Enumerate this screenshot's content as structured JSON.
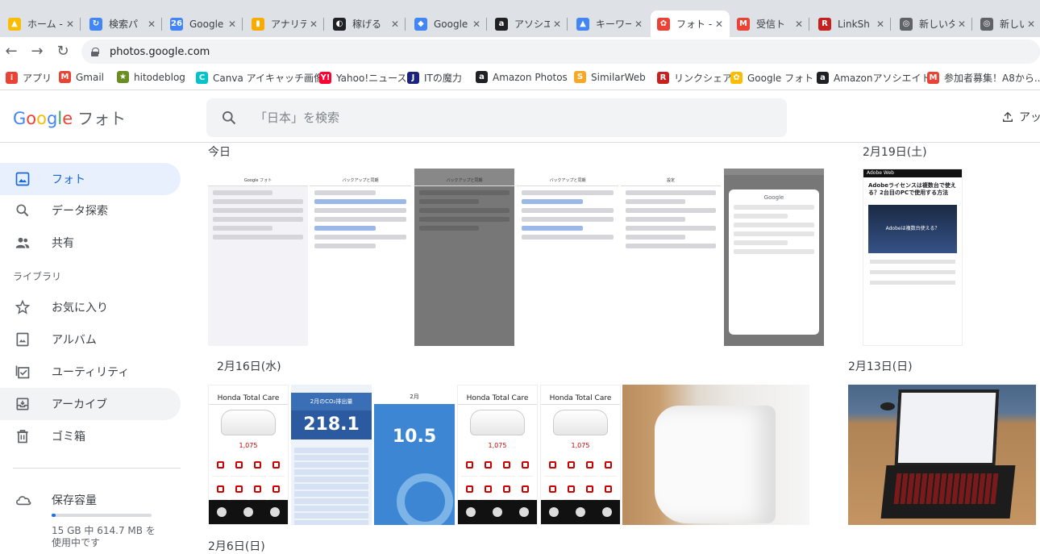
{
  "browser": {
    "tabs": [
      {
        "label": "ホーム -",
        "color": "#fbbc04",
        "glyph": "▲"
      },
      {
        "label": "検索パ",
        "color": "#4285f4",
        "glyph": "↻"
      },
      {
        "label": "Google",
        "color": "#4285f4",
        "glyph": "26"
      },
      {
        "label": "アナリテ",
        "color": "#f9ab00",
        "glyph": "▮"
      },
      {
        "label": "稼げる",
        "color": "#202124",
        "glyph": "◐"
      },
      {
        "label": "Google",
        "color": "#4285f4",
        "glyph": "◆"
      },
      {
        "label": "アソシエ",
        "color": "#202124",
        "glyph": "a"
      },
      {
        "label": "キーワー",
        "color": "#4285f4",
        "glyph": "▲"
      },
      {
        "label": "フォト -",
        "color": "#ea4335",
        "glyph": "✿"
      },
      {
        "label": "受信ト",
        "color": "#ea4335",
        "glyph": "M"
      },
      {
        "label": "LinkSh",
        "color": "#c5221f",
        "glyph": "R"
      },
      {
        "label": "新しいタ",
        "color": "#5f6368",
        "glyph": "◎"
      },
      {
        "label": "新しいタ",
        "color": "#5f6368",
        "glyph": "◎"
      }
    ],
    "url": "photos.google.com",
    "bookmarks": [
      {
        "label": "アプリ",
        "color": "#ea4335",
        "glyph": "⁞"
      },
      {
        "label": "Gmail",
        "color": "#ea4335",
        "glyph": "M"
      },
      {
        "label": "hitodeblog",
        "color": "#6b8e23",
        "glyph": "★"
      },
      {
        "label": "Canva アイキャッチ画像",
        "color": "#00c4cc",
        "glyph": "C"
      },
      {
        "label": "Yahoo!ニュース",
        "color": "#ff0033",
        "glyph": "Y!"
      },
      {
        "label": "ITの魔力",
        "color": "#1a237e",
        "glyph": "J"
      },
      {
        "label": "Amazon Photos",
        "color": "#202124",
        "glyph": "a"
      },
      {
        "label": "SimilarWeb",
        "color": "#f9a825",
        "glyph": "S"
      },
      {
        "label": "リンクシェア",
        "color": "#c5221f",
        "glyph": "R"
      },
      {
        "label": "Google フォト",
        "color": "#fbbc04",
        "glyph": "✿"
      },
      {
        "label": "Amazonアソシエイト",
        "color": "#202124",
        "glyph": "a"
      },
      {
        "label": "参加者募集！A8から...",
        "color": "#ea4335",
        "glyph": "M"
      }
    ]
  },
  "app": {
    "logo_word": "Google",
    "product": "フォト",
    "search_placeholder": "「日本」を検索",
    "upload_label": "アッ"
  },
  "sidebar": {
    "items": [
      {
        "label": "フォト",
        "icon": "photo-icon",
        "active": true
      },
      {
        "label": "データ探索",
        "icon": "search-icon",
        "active": false
      },
      {
        "label": "共有",
        "icon": "people-icon",
        "active": false
      }
    ],
    "library_heading": "ライブラリ",
    "library_items": [
      {
        "label": "お気に入り",
        "icon": "star-icon",
        "active": false
      },
      {
        "label": "アルバム",
        "icon": "album-icon",
        "active": false
      },
      {
        "label": "ユーティリティ",
        "icon": "checklist-icon",
        "active": false
      },
      {
        "label": "アーカイブ",
        "icon": "archive-icon",
        "active": true
      },
      {
        "label": "ゴミ箱",
        "icon": "trash-icon",
        "active": false
      }
    ],
    "storage": {
      "label": "保存容量",
      "used_fraction": 0.04,
      "detail": "15 GB 中 614.7 MB を使用中です"
    }
  },
  "timeline": {
    "groups": [
      {
        "date": "今日"
      },
      {
        "date": "2月19日(土)"
      },
      {
        "date": "2月16日(水)"
      },
      {
        "date": "2月13日(日)"
      },
      {
        "date": "2月6日(日)"
      }
    ],
    "thumb_texts": {
      "htc_title": "Honda Total Care",
      "htc_km": "1,075",
      "co2_title": "2月のCO₂排出量",
      "co2_value": "218.1",
      "eco_title": "2月",
      "eco_value": "10.5",
      "web_header": "Adobe Web",
      "web_title": "Adobeライセンスは複数台で使える？2台目のPCで使用する方法",
      "web_image_text": "Adobeは複数台使える？",
      "ios_header_1": "Google フォト",
      "ios_header_2": "バックアップと同期",
      "ios_header_3": "設定",
      "ios_header_4": "Google"
    }
  },
  "colors": {
    "accent": "#1a73e8",
    "active_bg": "#e8f0fe",
    "active_text": "#1967d2"
  }
}
